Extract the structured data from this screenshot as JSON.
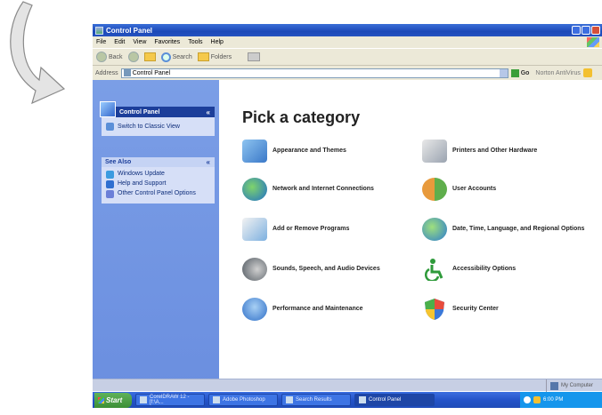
{
  "window": {
    "title": "Control Panel"
  },
  "menu": [
    "File",
    "Edit",
    "View",
    "Favorites",
    "Tools",
    "Help"
  ],
  "toolbar": {
    "back": "Back",
    "search": "Search",
    "folders": "Folders"
  },
  "address": {
    "label": "Address",
    "value": "Control Panel",
    "go": "Go",
    "links": "Norton AntiVirus"
  },
  "sidebar": {
    "control_panel_title": "Control Panel",
    "switch_view": "Switch to Classic View",
    "see_also_title": "See Also",
    "see_also": [
      "Windows Update",
      "Help and Support",
      "Other Control Panel Options"
    ]
  },
  "main": {
    "heading": "Pick a category",
    "categories": [
      "Appearance and Themes",
      "Printers and Other Hardware",
      "Network and Internet Connections",
      "User Accounts",
      "Add or Remove Programs",
      "Date, Time, Language, and Regional Options",
      "Sounds, Speech, and Audio Devices",
      "Accessibility Options",
      "Performance and Maintenance",
      "Security Center"
    ]
  },
  "statusbar": {
    "location": "My Computer"
  },
  "taskbar": {
    "start": "Start",
    "tasks": [
      "CorelDRAW 12 - [f:\\A...",
      "Adobe Photoshop",
      "Search Results",
      "Control Panel"
    ],
    "clock": "6:00 PM"
  }
}
